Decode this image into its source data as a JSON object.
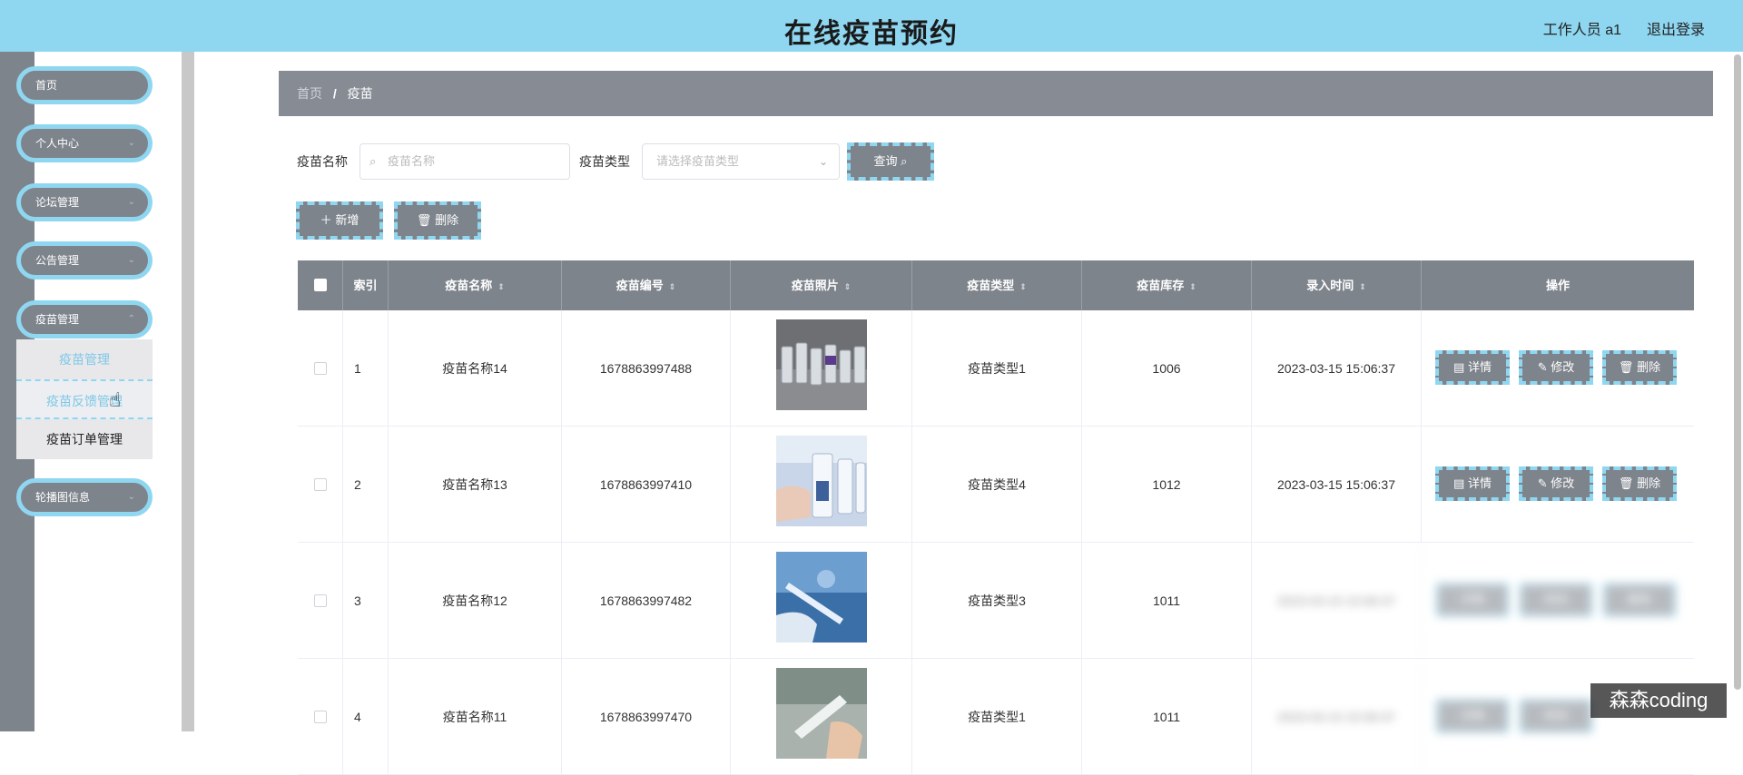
{
  "header": {
    "title": "在线疫苗预约",
    "user": "工作人员 a1",
    "logout": "退出登录"
  },
  "sidebar": {
    "items": [
      {
        "label": "首页"
      },
      {
        "label": "个人中心"
      },
      {
        "label": "论坛管理"
      },
      {
        "label": "公告管理"
      },
      {
        "label": "疫苗管理"
      },
      {
        "label": "轮播图信息"
      }
    ],
    "submenu": [
      "疫苗管理",
      "疫苗反馈管理",
      "疫苗订单管理"
    ]
  },
  "breadcrumb": {
    "home": "首页",
    "sep": "/",
    "current": "疫苗"
  },
  "search": {
    "name_label": "疫苗名称",
    "name_placeholder": "疫苗名称",
    "type_label": "疫苗类型",
    "type_placeholder": "请选择疫苗类型",
    "query_button": "查询"
  },
  "toolbar": {
    "add_button": "新增",
    "delete_button": "删除"
  },
  "table": {
    "columns": [
      "索引",
      "疫苗名称",
      "疫苗编号",
      "疫苗照片",
      "疫苗类型",
      "疫苗库存",
      "录入时间",
      "操作"
    ],
    "rows": [
      {
        "index": "1",
        "name": "疫苗名称14",
        "code": "1678863997488",
        "type": "疫苗类型1",
        "stock": "1006",
        "time": "2023-03-15 15:06:37"
      },
      {
        "index": "2",
        "name": "疫苗名称13",
        "code": "1678863997410",
        "type": "疫苗类型4",
        "stock": "1012",
        "time": "2023-03-15 15:06:37"
      },
      {
        "index": "3",
        "name": "疫苗名称12",
        "code": "1678863997482",
        "type": "疫苗类型3",
        "stock": "1011",
        "time": "2023-03-15 15:06:37"
      },
      {
        "index": "4",
        "name": "疫苗名称11",
        "code": "1678863997470",
        "type": "疫苗类型1",
        "stock": "1011",
        "time": "2023-03-15 15:06:37"
      }
    ],
    "actions": {
      "detail": "详情",
      "edit": "修改",
      "delete": "删除"
    }
  },
  "watermark": "森森coding",
  "colors": {
    "header_bg": "#8fd7f1",
    "sidebar_bg": "#7e848c",
    "accent": "#8fd7f1"
  }
}
